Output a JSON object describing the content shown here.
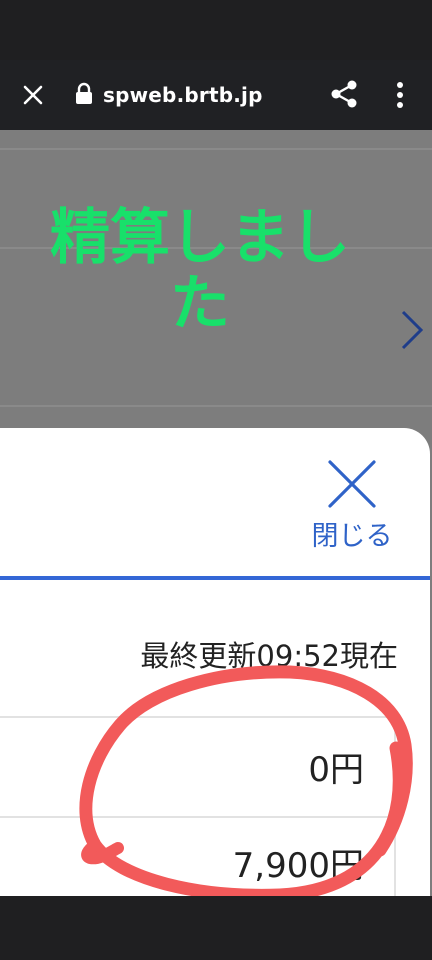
{
  "browser": {
    "url": "spweb.brtb.jp"
  },
  "page": {
    "banner_line1": "精算しまし",
    "banner_line2": "た"
  },
  "sheet": {
    "close_label": "閉じる",
    "last_updated": "最終更新09:52現在",
    "rows": [
      {
        "amount": "0円"
      },
      {
        "amount": "7,900円"
      }
    ]
  },
  "colors": {
    "accent": "#3367d6",
    "banner_green": "#18e06a",
    "annotation_red": "#f25a5a"
  }
}
